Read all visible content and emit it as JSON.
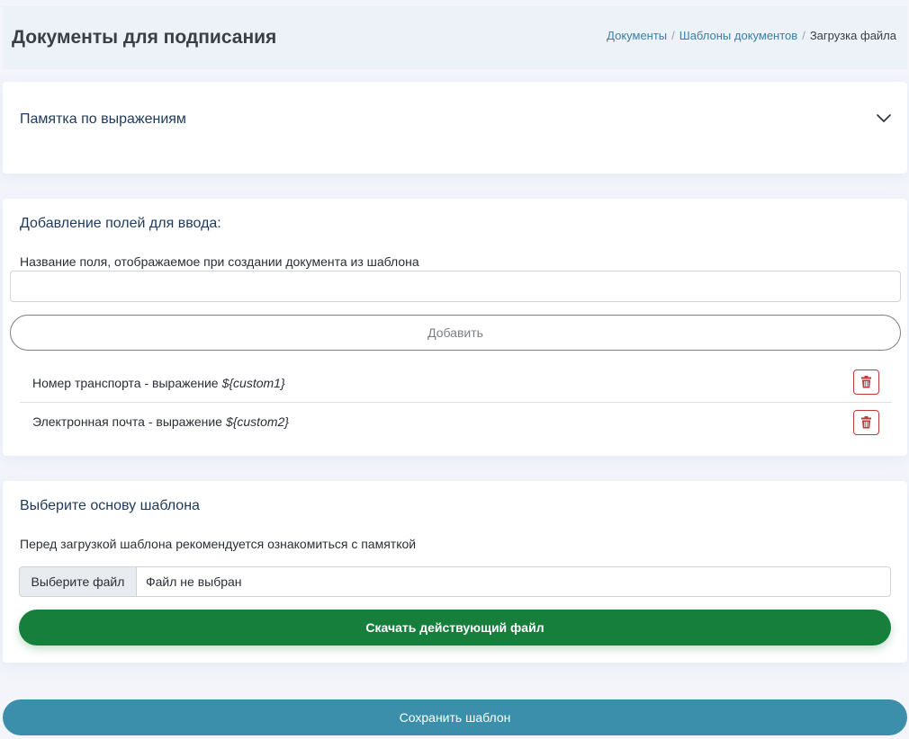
{
  "header": {
    "title": "Документы для подписания",
    "breadcrumb": [
      {
        "label": "Документы"
      },
      {
        "label": "Шаблоны документов"
      },
      {
        "label": "Загрузка файла"
      }
    ],
    "separator": "/"
  },
  "memo": {
    "title": "Памятка по выражениям",
    "toggle_icon": "chevron-down-icon"
  },
  "fields_section": {
    "title": "Добавление полей для ввода:",
    "input_label": "Название поля, отображаемое при создании документа из шаблона",
    "input_value": "",
    "input_placeholder": "",
    "add_label": "Добавить",
    "items": [
      {
        "name": "Номер транспорта - выражение",
        "expression": "${custom1}",
        "delete_icon": "trash-icon"
      },
      {
        "name": "Электронная почта - выражение",
        "expression": "${custom2}",
        "delete_icon": "trash-icon"
      }
    ]
  },
  "base_section": {
    "title": "Выберите основу шаблона",
    "hint": "Перед загрузкой шаблона рекомендуется ознакомиться с памяткой",
    "choose_file_label": "Выберите файл",
    "file_status": "Файл не выбран",
    "download_label": "Скачать действующий файл"
  },
  "save_label": "Сохранить шаблон",
  "colors": {
    "background": "#f3f5fb",
    "link": "#3b7fa4",
    "download_button": "#157f3b",
    "save_button": "#3b8fab",
    "danger": "#c0393b"
  }
}
